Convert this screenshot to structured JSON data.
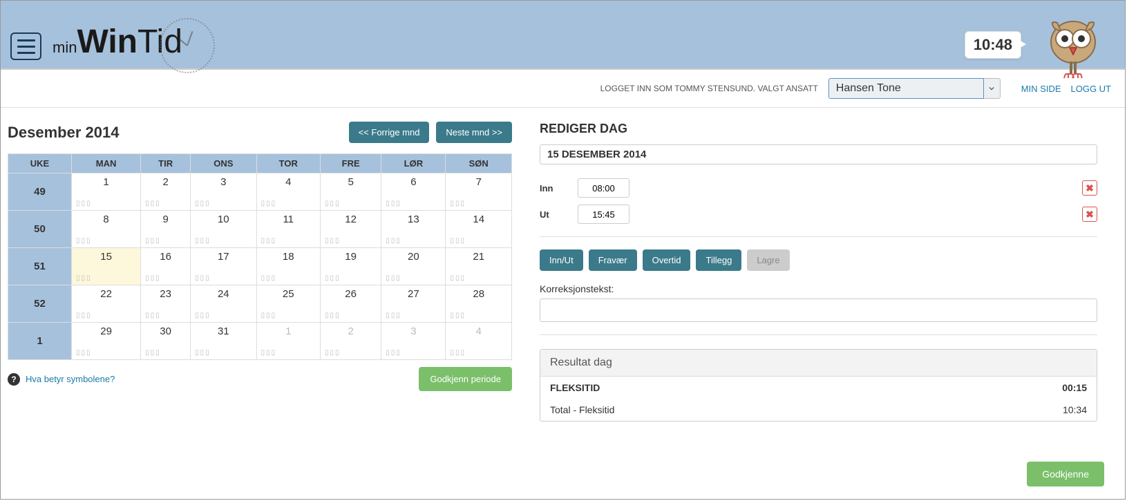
{
  "header": {
    "logo_min": "min",
    "logo_win": "Win",
    "logo_tid": "Tid",
    "time": "10:48"
  },
  "subheader": {
    "login_text": "LOGGET INN SOM TOMMY STENSUND.  VALGT ANSATT",
    "employee": "Hansen Tone",
    "min_side": "MIN SIDE",
    "logg_ut": "LOGG UT"
  },
  "calendar": {
    "title": "Desember 2014",
    "prev": "<< Forrige mnd",
    "next": "Neste mnd >>",
    "headers": [
      "UKE",
      "MAN",
      "TIR",
      "ONS",
      "TOR",
      "FRE",
      "LØR",
      "SØN"
    ],
    "weeks": [
      {
        "wk": "49",
        "days": [
          {
            "n": "1"
          },
          {
            "n": "2"
          },
          {
            "n": "3"
          },
          {
            "n": "4"
          },
          {
            "n": "5"
          },
          {
            "n": "6"
          },
          {
            "n": "7"
          }
        ]
      },
      {
        "wk": "50",
        "days": [
          {
            "n": "8"
          },
          {
            "n": "9"
          },
          {
            "n": "10"
          },
          {
            "n": "11"
          },
          {
            "n": "12"
          },
          {
            "n": "13"
          },
          {
            "n": "14"
          }
        ]
      },
      {
        "wk": "51",
        "days": [
          {
            "n": "15",
            "sel": true
          },
          {
            "n": "16"
          },
          {
            "n": "17"
          },
          {
            "n": "18"
          },
          {
            "n": "19"
          },
          {
            "n": "20"
          },
          {
            "n": "21"
          }
        ]
      },
      {
        "wk": "52",
        "days": [
          {
            "n": "22"
          },
          {
            "n": "23"
          },
          {
            "n": "24"
          },
          {
            "n": "25"
          },
          {
            "n": "26"
          },
          {
            "n": "27"
          },
          {
            "n": "28"
          }
        ]
      },
      {
        "wk": "1",
        "days": [
          {
            "n": "29"
          },
          {
            "n": "30"
          },
          {
            "n": "31"
          },
          {
            "n": "1",
            "other": true
          },
          {
            "n": "2",
            "other": true
          },
          {
            "n": "3",
            "other": true
          },
          {
            "n": "4",
            "other": true
          }
        ]
      }
    ],
    "legend_link": "Hva betyr symbolene?",
    "approve_period": "Godkjenn periode"
  },
  "edit": {
    "title": "REDIGER DAG",
    "date": "15 DESEMBER 2014",
    "in_label": "Inn",
    "in_value": "08:00",
    "out_label": "Ut",
    "out_value": "15:45",
    "btn_innut": "Inn/Ut",
    "btn_fravaer": "Fravær",
    "btn_overtid": "Overtid",
    "btn_tillegg": "Tillegg",
    "btn_lagre": "Lagre",
    "korr_label": "Korreksjonstekst:",
    "korr_value": "",
    "result_head": "Resultat dag",
    "result_rows": [
      {
        "label": "FLEKSITID",
        "value": "00:15",
        "bold": true
      },
      {
        "label": "Total - Fleksitid",
        "value": "10:34",
        "bold": false
      }
    ],
    "godkjenn": "Godkjenne"
  }
}
